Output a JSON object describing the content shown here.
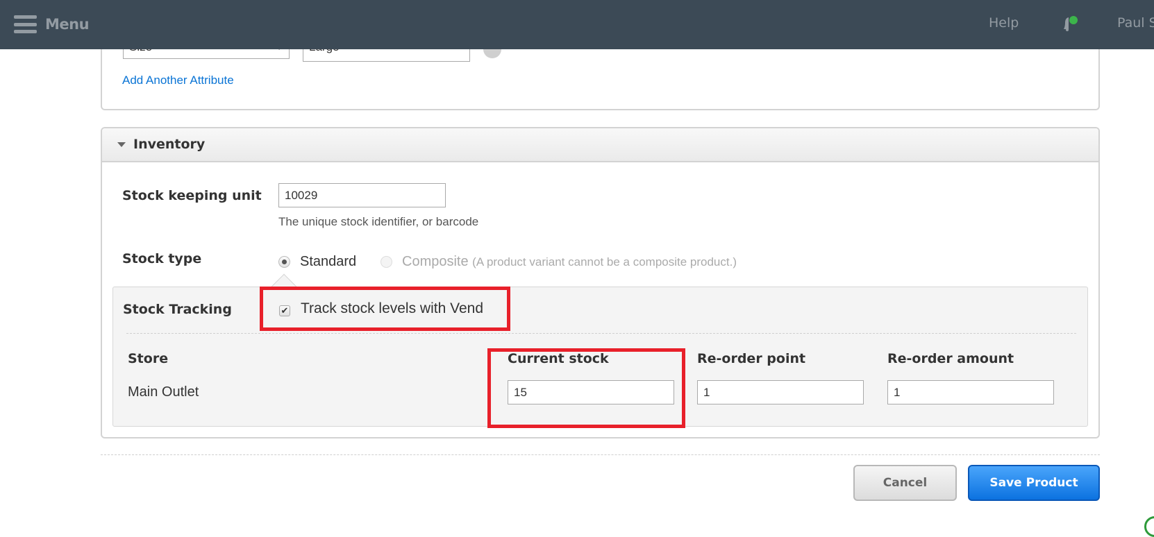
{
  "topbar": {
    "menu_label": "Menu",
    "help_label": "Help",
    "user_name": "Paul S",
    "notification_dot_color": "#3cb44b"
  },
  "attributes": {
    "attribute_name": "Size",
    "attribute_value": "Large",
    "add_link": "Add Another Attribute"
  },
  "inventory": {
    "section_title": "Inventory",
    "sku": {
      "label": "Stock keeping unit",
      "value": "10029",
      "help": "The unique stock identifier, or barcode"
    },
    "stock_type": {
      "label": "Stock type",
      "options": [
        {
          "label": "Standard",
          "selected": true,
          "disabled": false
        },
        {
          "label": "Composite",
          "selected": false,
          "disabled": true
        }
      ],
      "composite_note": "(A product variant cannot be a composite product.)"
    },
    "tracking": {
      "label": "Stock Tracking",
      "checkbox_label": "Track stock levels with Vend",
      "checked": true,
      "columns": [
        "Store",
        "Current stock",
        "Re-order point",
        "Re-order amount"
      ],
      "rows": [
        {
          "store": "Main Outlet",
          "current_stock": "15",
          "reorder_point": "1",
          "reorder_amount": "1"
        }
      ]
    }
  },
  "actions": {
    "cancel_label": "Cancel",
    "save_label": "Save Product"
  },
  "colors": {
    "topbar_bg": "#3c4a56",
    "link": "#0a74d5",
    "primary_button": "#1a82ea",
    "highlight": "#e8202a"
  }
}
